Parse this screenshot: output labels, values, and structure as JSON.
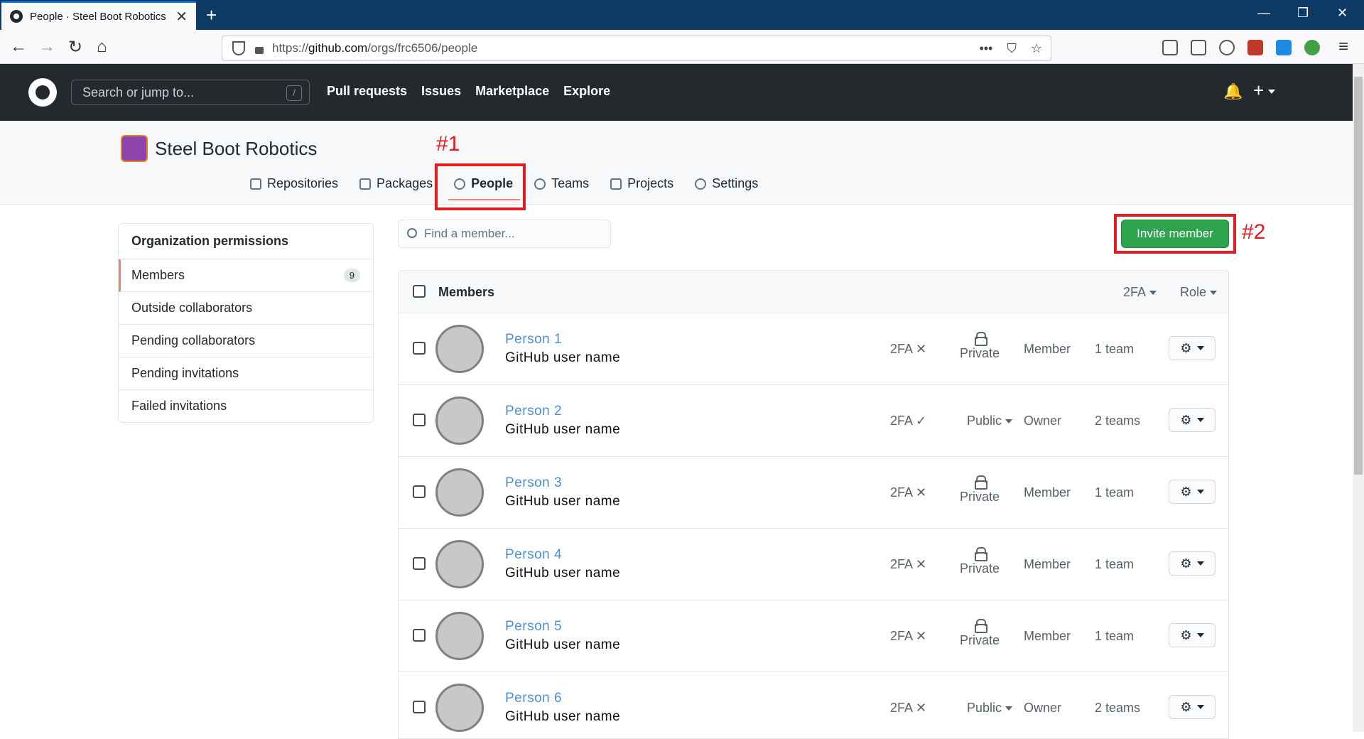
{
  "browser": {
    "tab_title": "People · Steel Boot Robotics",
    "tab_close": "✕",
    "new_tab": "+",
    "url_host_prefix": "https://",
    "url_host": "github.com",
    "url_path": "/orgs/frc6506/people",
    "url_more": "•••",
    "win_min": "—",
    "win_restore": "❐",
    "win_close": "✕"
  },
  "github": {
    "search_placeholder": "Search or jump to...",
    "search_shortcut": "/",
    "nav": [
      "Pull requests",
      "Issues",
      "Marketplace",
      "Explore"
    ],
    "bell": "🔔",
    "plus": "+"
  },
  "org": {
    "name": "Steel Boot Robotics",
    "tabs": [
      "Repositories",
      "Packages",
      "People",
      "Teams",
      "Projects",
      "Settings"
    ],
    "active_tab": "People"
  },
  "annotations": {
    "one": "#1",
    "two": "#2",
    "color": "#e31b23"
  },
  "sidebar": {
    "heading": "Organization permissions",
    "items": [
      {
        "label": "Members",
        "count": "9"
      },
      {
        "label": "Outside collaborators"
      },
      {
        "label": "Pending collaborators"
      },
      {
        "label": "Pending invitations"
      },
      {
        "label": "Failed invitations"
      }
    ]
  },
  "main": {
    "find_placeholder": "Find a member...",
    "invite_label": "Invite member",
    "header": {
      "label": "Members",
      "twofa": "2FA",
      "role": "Role"
    },
    "members": [
      {
        "name": "Person 1",
        "username": "GitHub user name",
        "twofa": "2FA ✕",
        "visibility": "Private",
        "role": "Member",
        "teams": "1 team"
      },
      {
        "name": "Person 2",
        "username": "GitHub user name",
        "twofa": "2FA ✓",
        "visibility": "Public",
        "role": "Owner",
        "teams": "2 teams"
      },
      {
        "name": "Person 3",
        "username": "GitHub user name",
        "twofa": "2FA ✕",
        "visibility": "Private",
        "role": "Member",
        "teams": "1 team"
      },
      {
        "name": "Person 4",
        "username": "GitHub user name",
        "twofa": "2FA ✕",
        "visibility": "Private",
        "role": "Member",
        "teams": "1 team"
      },
      {
        "name": "Person 5",
        "username": "GitHub user name",
        "twofa": "2FA ✕",
        "visibility": "Private",
        "role": "Member",
        "teams": "1 team"
      },
      {
        "name": "Person 6",
        "username": "GitHub user name",
        "twofa": "2FA ✕",
        "visibility": "Public",
        "role": "Owner",
        "teams": "2 teams"
      }
    ],
    "gear_glyph": "⚙"
  },
  "colors": {
    "accent_green": "#2ea44f",
    "link_blue": "#4a90d9",
    "github_dark": "#24292e"
  }
}
